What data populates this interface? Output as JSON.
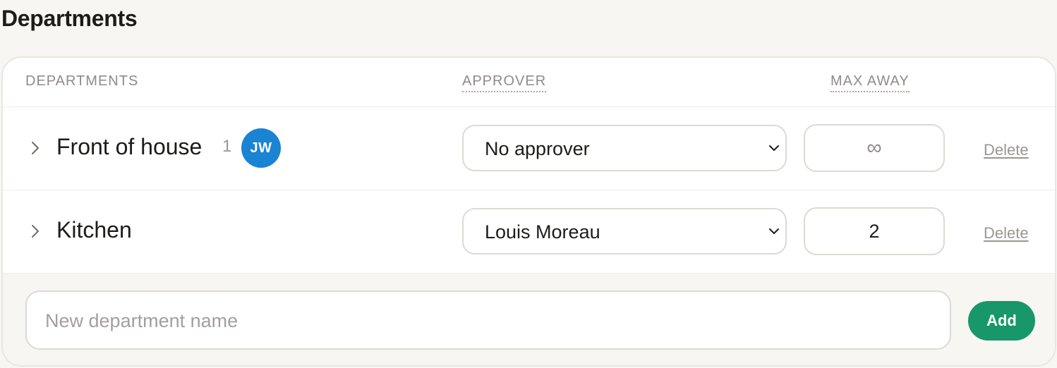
{
  "page": {
    "title": "Departments"
  },
  "table": {
    "headers": {
      "departments": "DEPARTMENTS",
      "approver": "APPROVER",
      "max_away": "MAX AWAY"
    },
    "rows": [
      {
        "name": "Front of house",
        "count": "1",
        "avatar_initials": "JW",
        "approver": "No approver",
        "max_away": "∞",
        "delete_label": "Delete"
      },
      {
        "name": "Kitchen",
        "approver": "Louis Moreau",
        "max_away": "2",
        "delete_label": "Delete"
      }
    ]
  },
  "footer": {
    "new_department_placeholder": "New department name",
    "add_label": "Add"
  },
  "colors": {
    "accent": "#17976a",
    "avatar": "#1a83d4"
  }
}
